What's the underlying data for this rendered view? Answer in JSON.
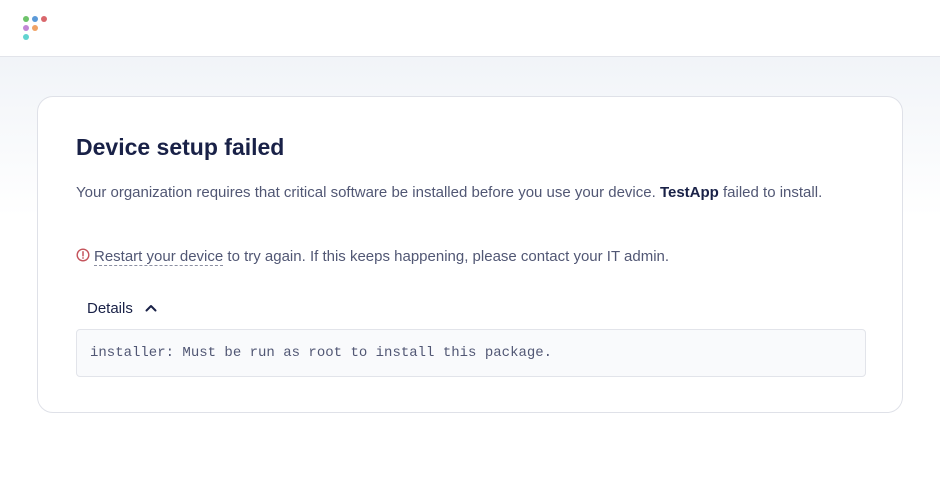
{
  "colors": {
    "logo_dots": [
      "#6ec36b",
      "#5b9ad8",
      "#d9676c",
      "#c286d6",
      "#f0a366",
      "#62d3d0"
    ],
    "alert_icon": "#c4535b",
    "heading": "#192147",
    "body_text": "#515774"
  },
  "icons": {
    "logo": "app-logo-dots",
    "alert": "exclamation-circle-icon",
    "details_toggle": "chevron-up-icon"
  },
  "main": {
    "title": "Device setup failed",
    "description": {
      "before": "Your organization requires that critical software be installed before you use your device. ",
      "app_name": "TestApp",
      "after": " failed to install."
    },
    "restart": {
      "link_text": "Restart your device",
      "rest_text": " to try again. If this keeps happening, please contact your IT admin."
    },
    "details": {
      "label": "Details",
      "expanded": true,
      "text": "installer: Must be run as root to install this package."
    }
  }
}
